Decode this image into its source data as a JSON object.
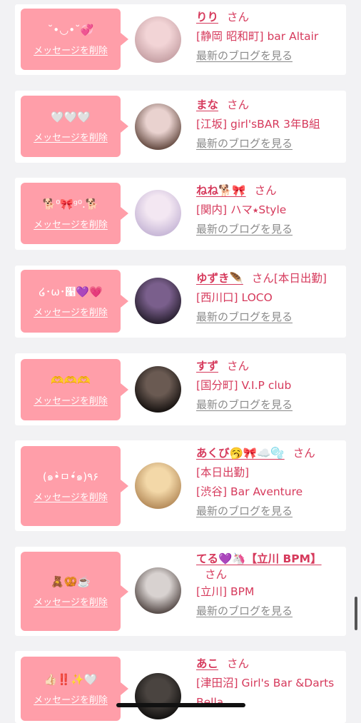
{
  "messages": [
    {
      "message": "˘•◡•˘💞",
      "delete_label": "メッセージを削除",
      "name": "りり",
      "honorific": "さん",
      "extra": "",
      "lines": [
        "[静岡 昭和町] bar Altair"
      ],
      "blog_label": "最新のブログを見る",
      "avatar_colors": [
        "#f2d4d6",
        "#c8a3a7"
      ]
    },
    {
      "message": "🤍🤍🤍",
      "delete_label": "メッセージを削除",
      "name": "まな",
      "honorific": "さん",
      "extra": "",
      "lines": [
        "[江坂] girl'sBAR 3年B組"
      ],
      "blog_label": "最新のブログを見る",
      "avatar_colors": [
        "#e9d2cf",
        "#6b5148"
      ]
    },
    {
      "message": "🐕⁰🎀ᵍ⁰.🐕",
      "delete_label": "メッセージを削除",
      "name": "ねね🐕🎀",
      "honorific": "さん",
      "extra": "",
      "lines": [
        "[関内] ハマ⭑Style"
      ],
      "blog_label": "最新のブログを見る",
      "avatar_colors": [
        "#f3e7f2",
        "#c9b9d8"
      ]
    },
    {
      "message": "໒･ω･໡💜💗",
      "delete_label": "メッセージを削除",
      "name": "ゆずき🪶",
      "honorific": "さん",
      "extra": "[本日出勤]",
      "lines": [
        "[西川口] LOCO"
      ],
      "blog_label": "最新のブログを見る",
      "avatar_colors": [
        "#7a5f8c",
        "#2b2233"
      ]
    },
    {
      "message": "🫶🫶🫶",
      "delete_label": "メッセージを削除",
      "name": "すず",
      "honorific": "さん",
      "extra": "",
      "lines": [
        "[国分町] V.I.P club"
      ],
      "blog_label": "最新のブログを見る",
      "avatar_colors": [
        "#6a5a52",
        "#1a1513"
      ]
    },
    {
      "message": "(๑•̀ㅁ•́๑)٩۶",
      "delete_label": "メッセージを削除",
      "name": "あくび🥱🎀☁️🫧",
      "honorific": "さん",
      "extra": "",
      "lines": [
        "[本日出勤]",
        "[渋谷] Bar Aventure"
      ],
      "blog_label": "最新のブログを見る",
      "avatar_colors": [
        "#f3d8a8",
        "#b88f5e"
      ]
    },
    {
      "message": "🧸🥨☕️",
      "delete_label": "メッセージを削除",
      "name": "てる💜🦄【立川 BPM】",
      "honorific": "さん",
      "extra": "",
      "lines": [
        "[立川] BPM"
      ],
      "blog_label": "最新のブログを見る",
      "avatar_colors": [
        "#d8d2d0",
        "#5a4f4c"
      ]
    },
    {
      "message": "👍🏻‼️✨🤍",
      "delete_label": "メッセージを削除",
      "name": "あこ",
      "honorific": "さん",
      "extra": "",
      "lines": [
        "[津田沼] Girl's Bar &Darts Bella"
      ],
      "blog_label": "",
      "avatar_colors": [
        "#4a4440",
        "#151312"
      ]
    }
  ]
}
